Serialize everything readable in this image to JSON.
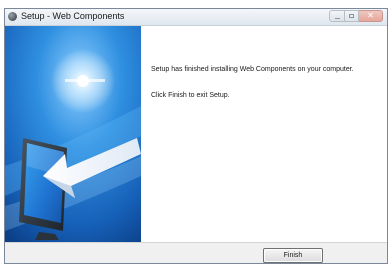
{
  "window": {
    "title": "Setup - Web Components",
    "app_icon": "setup-globe-icon"
  },
  "caption_buttons": {
    "minimize_icon": "minimize-icon",
    "maximize_icon": "maximize-icon",
    "close_icon": "close-icon",
    "close_glyph": "✕"
  },
  "side_panel": {
    "image": "monitor-arrow-graphic",
    "accent_color": "#2f7fd3"
  },
  "content": {
    "message_line1": "Setup has finished installing Web Components on your computer.",
    "message_line2": "Click Finish to exit Setup."
  },
  "footer": {
    "finish_label": "Finish"
  }
}
